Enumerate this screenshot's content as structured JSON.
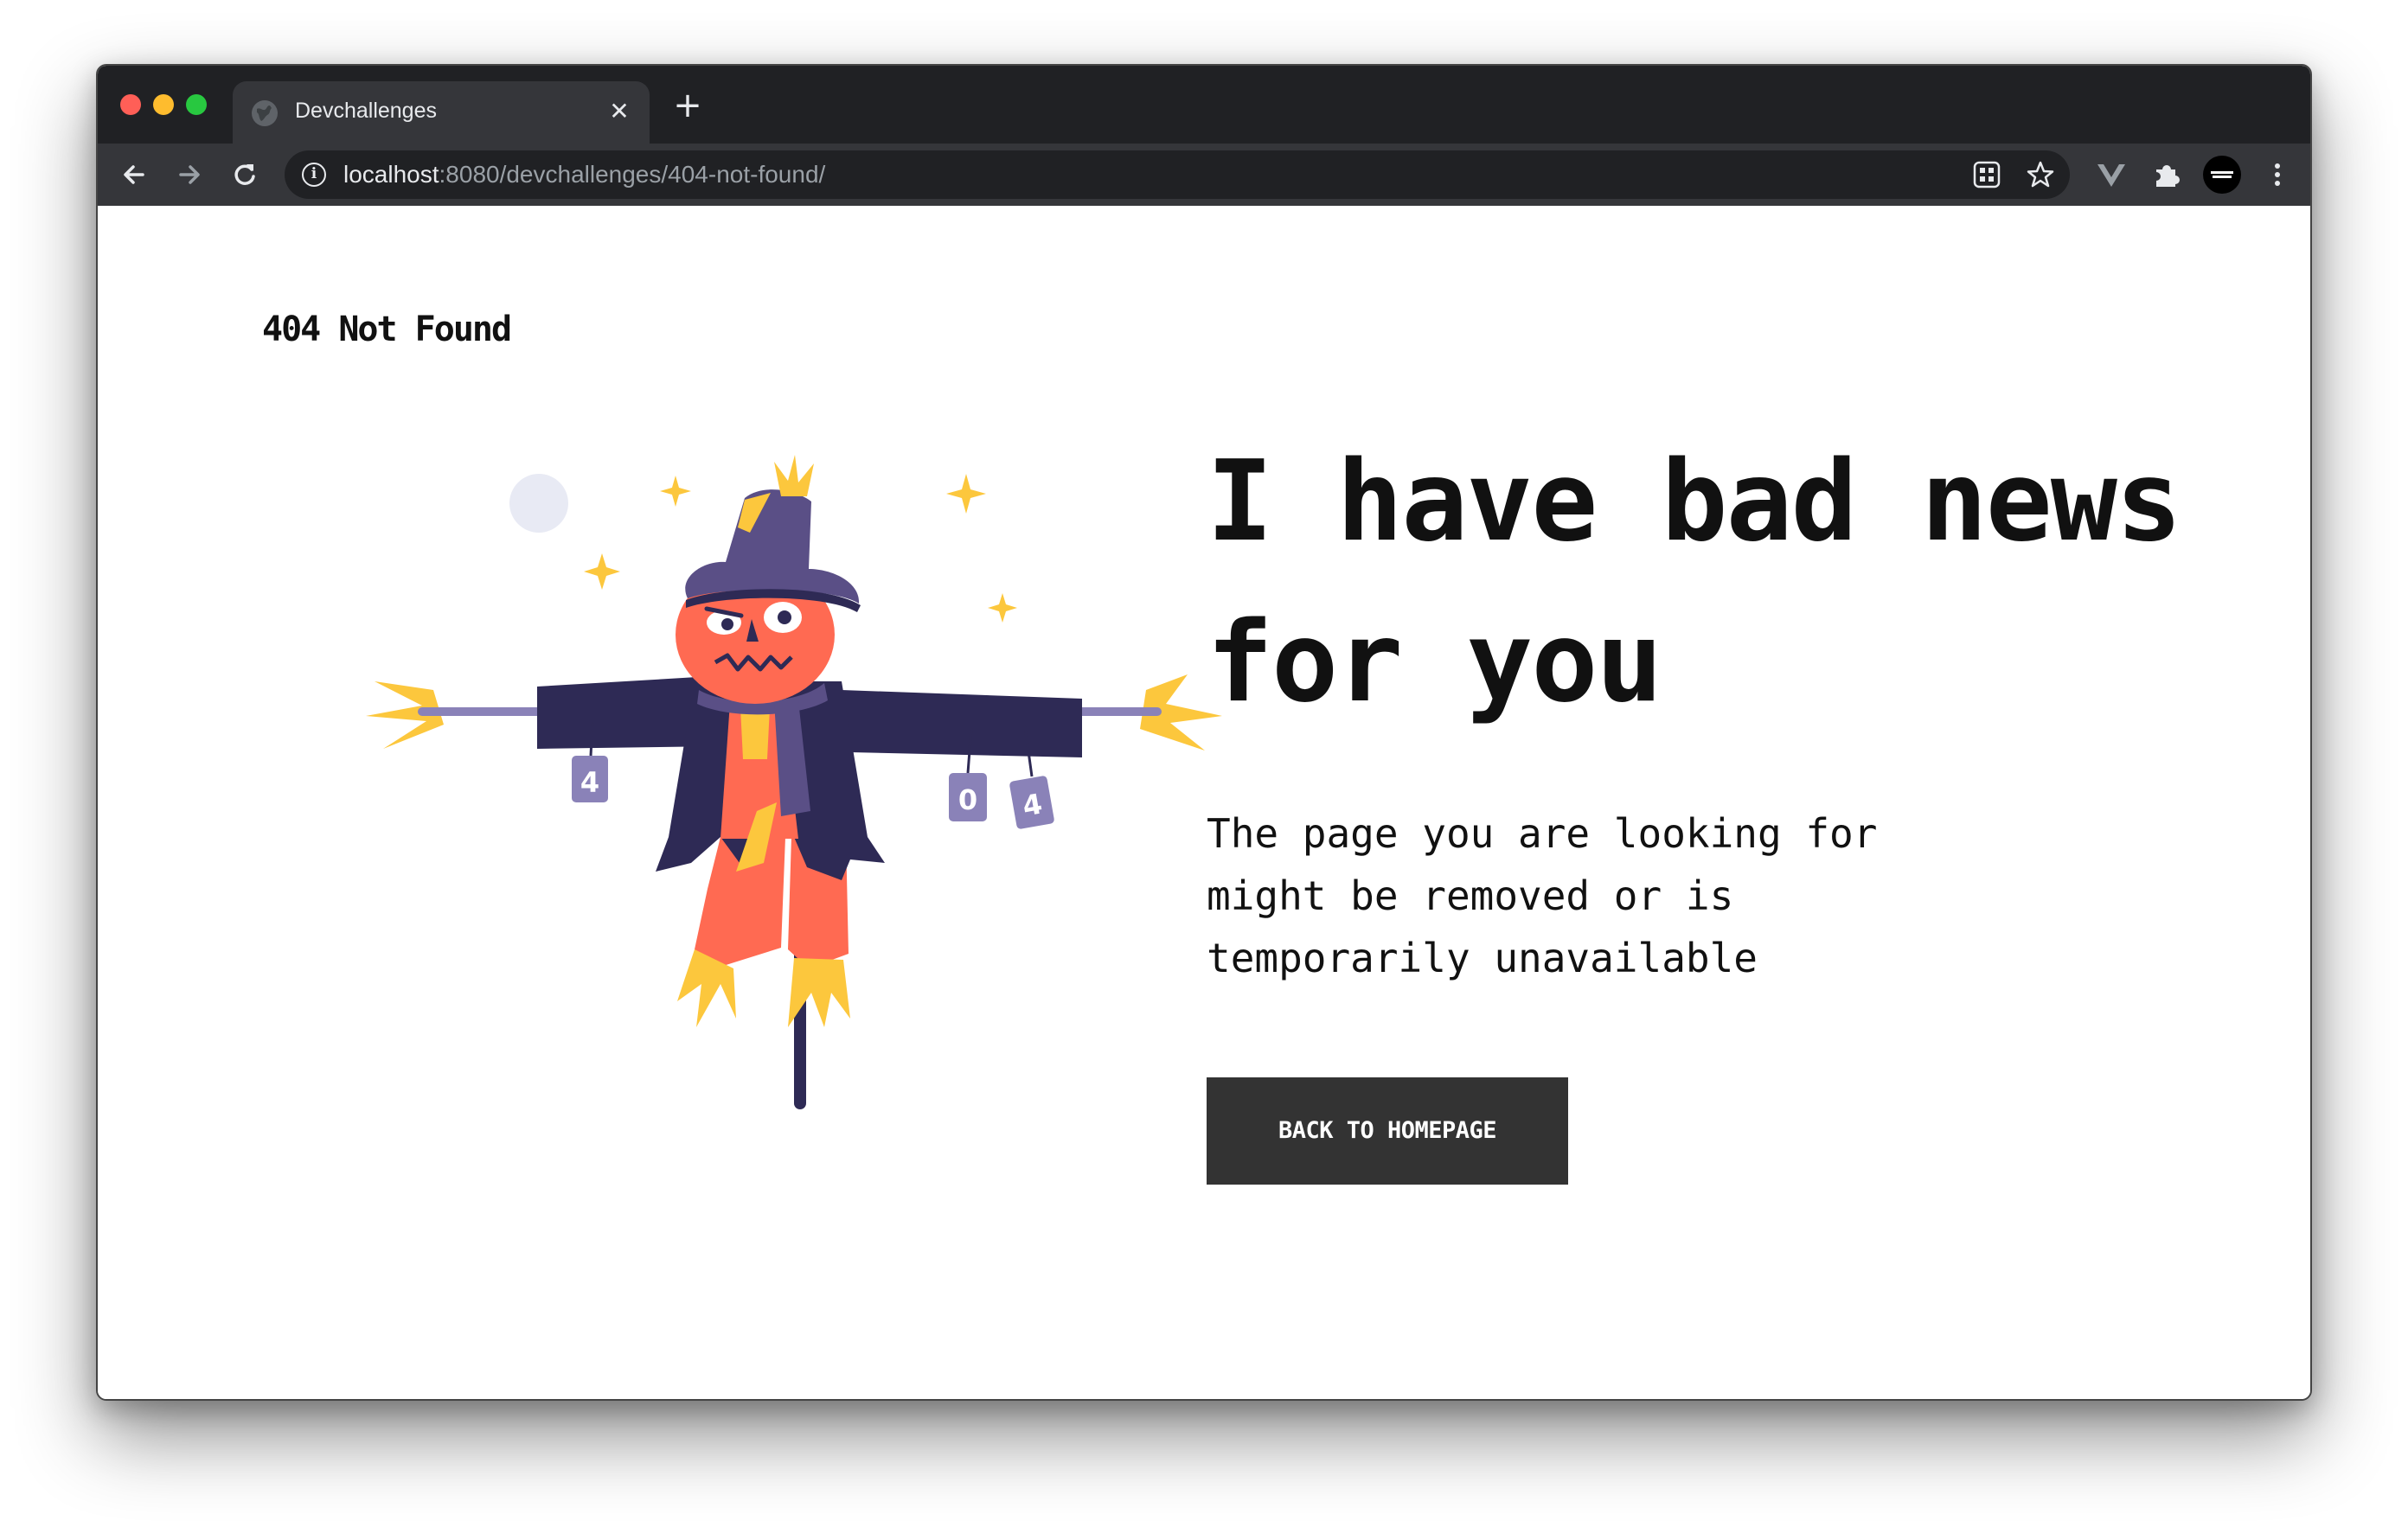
{
  "browser": {
    "tab": {
      "title": "Devchallenges",
      "favicon_icon": "globe-icon",
      "close_icon": "close-icon"
    },
    "new_tab_icon": "plus-icon",
    "toolbar": {
      "back_icon": "arrow-left-icon",
      "forward_icon": "arrow-right-icon",
      "reload_icon": "reload-icon",
      "site_info_icon": "info-icon",
      "url_host": "localhost",
      "url_path": ":8080/devchallenges/404-not-found/",
      "omnibox_icons": [
        "qr-code-icon",
        "star-icon"
      ],
      "extension_icons": [
        "vue-devtools-icon",
        "puzzle-icon",
        "profile-avatar-icon",
        "menu-kebab-icon"
      ]
    }
  },
  "page": {
    "logo": "404 Not Found",
    "illustration": {
      "icon": "scarecrow-illustration",
      "can_labels": [
        "4",
        "0",
        "4"
      ]
    },
    "headline": "I have bad news for you",
    "body": "The page you are looking for might be removed or is temporarily unavailable",
    "cta_label": "BACK TO HOMEPAGE"
  },
  "colors": {
    "browser_chrome": "#202124",
    "browser_tab": "#35363a",
    "button_bg": "#333333",
    "scarecrow_coat": "#2e2a55",
    "scarecrow_face": "#ff6a52",
    "straw": "#fcc73d",
    "hat": "#5a4f86"
  }
}
